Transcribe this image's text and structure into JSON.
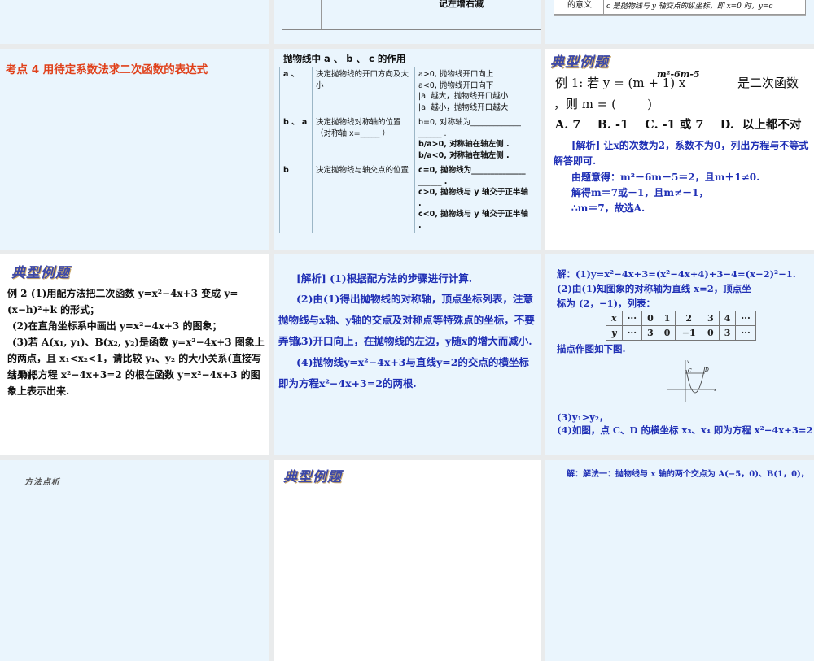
{
  "row0": {
    "mid_cell": "记左增右减",
    "right_label": "的意义",
    "right_text": "c 是抛物线与 y 轴交点的纵坐标，即 x=0 时，y=c"
  },
  "slide_kaodian": {
    "title": "考点 4   用待定系数法求二次函数的表达式"
  },
  "slide_abc": {
    "title": "抛物线中 a 、 b 、 c 的作用",
    "rows": [
      {
        "k": "a 、",
        "desc": "决定抛物线的开口方向及大小",
        "lines": [
          "a>0, 抛物线开口向上",
          "a<0, 抛物线开口向下",
          "|a| 越大，抛物线开口越小",
          "|a| 越小，抛物线开口越大"
        ]
      },
      {
        "k": "b 、 a",
        "desc": "决定抛物线对称轴的位置（对称轴 x=_____ ）",
        "lines": [
          "b=0, 对称轴为_____________",
          "______  .",
          "b/a>0, 对称轴在轴左侧 .",
          "b/a<0, 对称轴在轴左侧 ."
        ]
      },
      {
        "k": "b",
        "desc": "决定抛物线与轴交点的位置",
        "lines": [
          "c=0, 抛物线为______________",
          "______  .",
          "c>0, 抛物线与 y 轴交于正半轴 .",
          "c<0, 抛物线与 y 轴交于正半轴 ."
        ]
      }
    ]
  },
  "logo_text": "典型例题",
  "slide_ex1": {
    "q1": "例 1: 若 y = (m + 1) x",
    "exp": "m²-6m-5",
    "q1b": "是二次函数",
    "q2": "，则 m = (        )",
    "options": "A. 7    B. -1    C. -1 或 7    D.  以上都不对",
    "sol": [
      "[解析]  让x的次数为2，系数不为0，列出方程与不等式解答即可.",
      "由题意得：m²－6m－5＝2，且m＋1≠0.",
      "解得m＝7或－1，且m≠－1，",
      "∴m＝7，故选A."
    ]
  },
  "slide_ex2": {
    "lines": [
      "例 2 (1)用配方法把二次函数 y=x²−4x+3 变成 y=(x−h)²+k 的形式；",
      "(2)在直角坐标系中画出 y=x²−4x+3 的图象；",
      "(3)若 A(x₁, y₁)、B(x₂, y₂)是函数 y=x²−4x+3 图象上的两点，且 x₁<x₂<1，请比较 y₁、y₂ 的大小关系(直接写结果)；",
      "(4)把方程 x²−4x+3=2 的根在函数 y=x²−4x+3 的图象上表示出来."
    ]
  },
  "slide_analysis": {
    "lines": [
      "[解析] (1)根据配方法的步骤进行计算.",
      "(2)由(1)得出抛物线的对称轴，顶点坐标列表，注意抛物线与x轴、y轴的交点及对称点等特殊点的坐标，不要弄错.",
      "(3)开口向上，在抛物线的左边，y随x的增大而减小.",
      "(4)抛物线y=x²−4x+3与直线y=2的交点的横坐标即为方程x²−4x+3=2的两根."
    ]
  },
  "slide_solution": {
    "l1": "解：(1)y=x²−4x+3=(x²−4x+4)+3−4=(x−2)²−1.",
    "l2": "(2)由(1)知图象的对称轴为直线 x=2，顶点坐标为 (2，−1)，列表：",
    "table": {
      "x": [
        "x",
        "···",
        "0",
        "1",
        "2",
        "3",
        "4",
        "···"
      ],
      "y": [
        "y",
        "···",
        "3",
        "0",
        "−1",
        "0",
        "3",
        "···"
      ]
    },
    "l3": "描点作图如下图.",
    "l4": "(3)y₁>y₂，",
    "l5": "(4)如图，点 C、D 的横坐标 x₃、x₄ 即为方程 x²−4x+3=2 的根.",
    "graph": {
      "c": "C",
      "d": "D",
      "xlabel": "x",
      "ylabel": "y"
    }
  },
  "row3": {
    "left_logo": "方法点析",
    "right_text": "解：解法一：抛物线与 x 轴的两个交点为 A(−5，0)、B(1，0)，"
  }
}
